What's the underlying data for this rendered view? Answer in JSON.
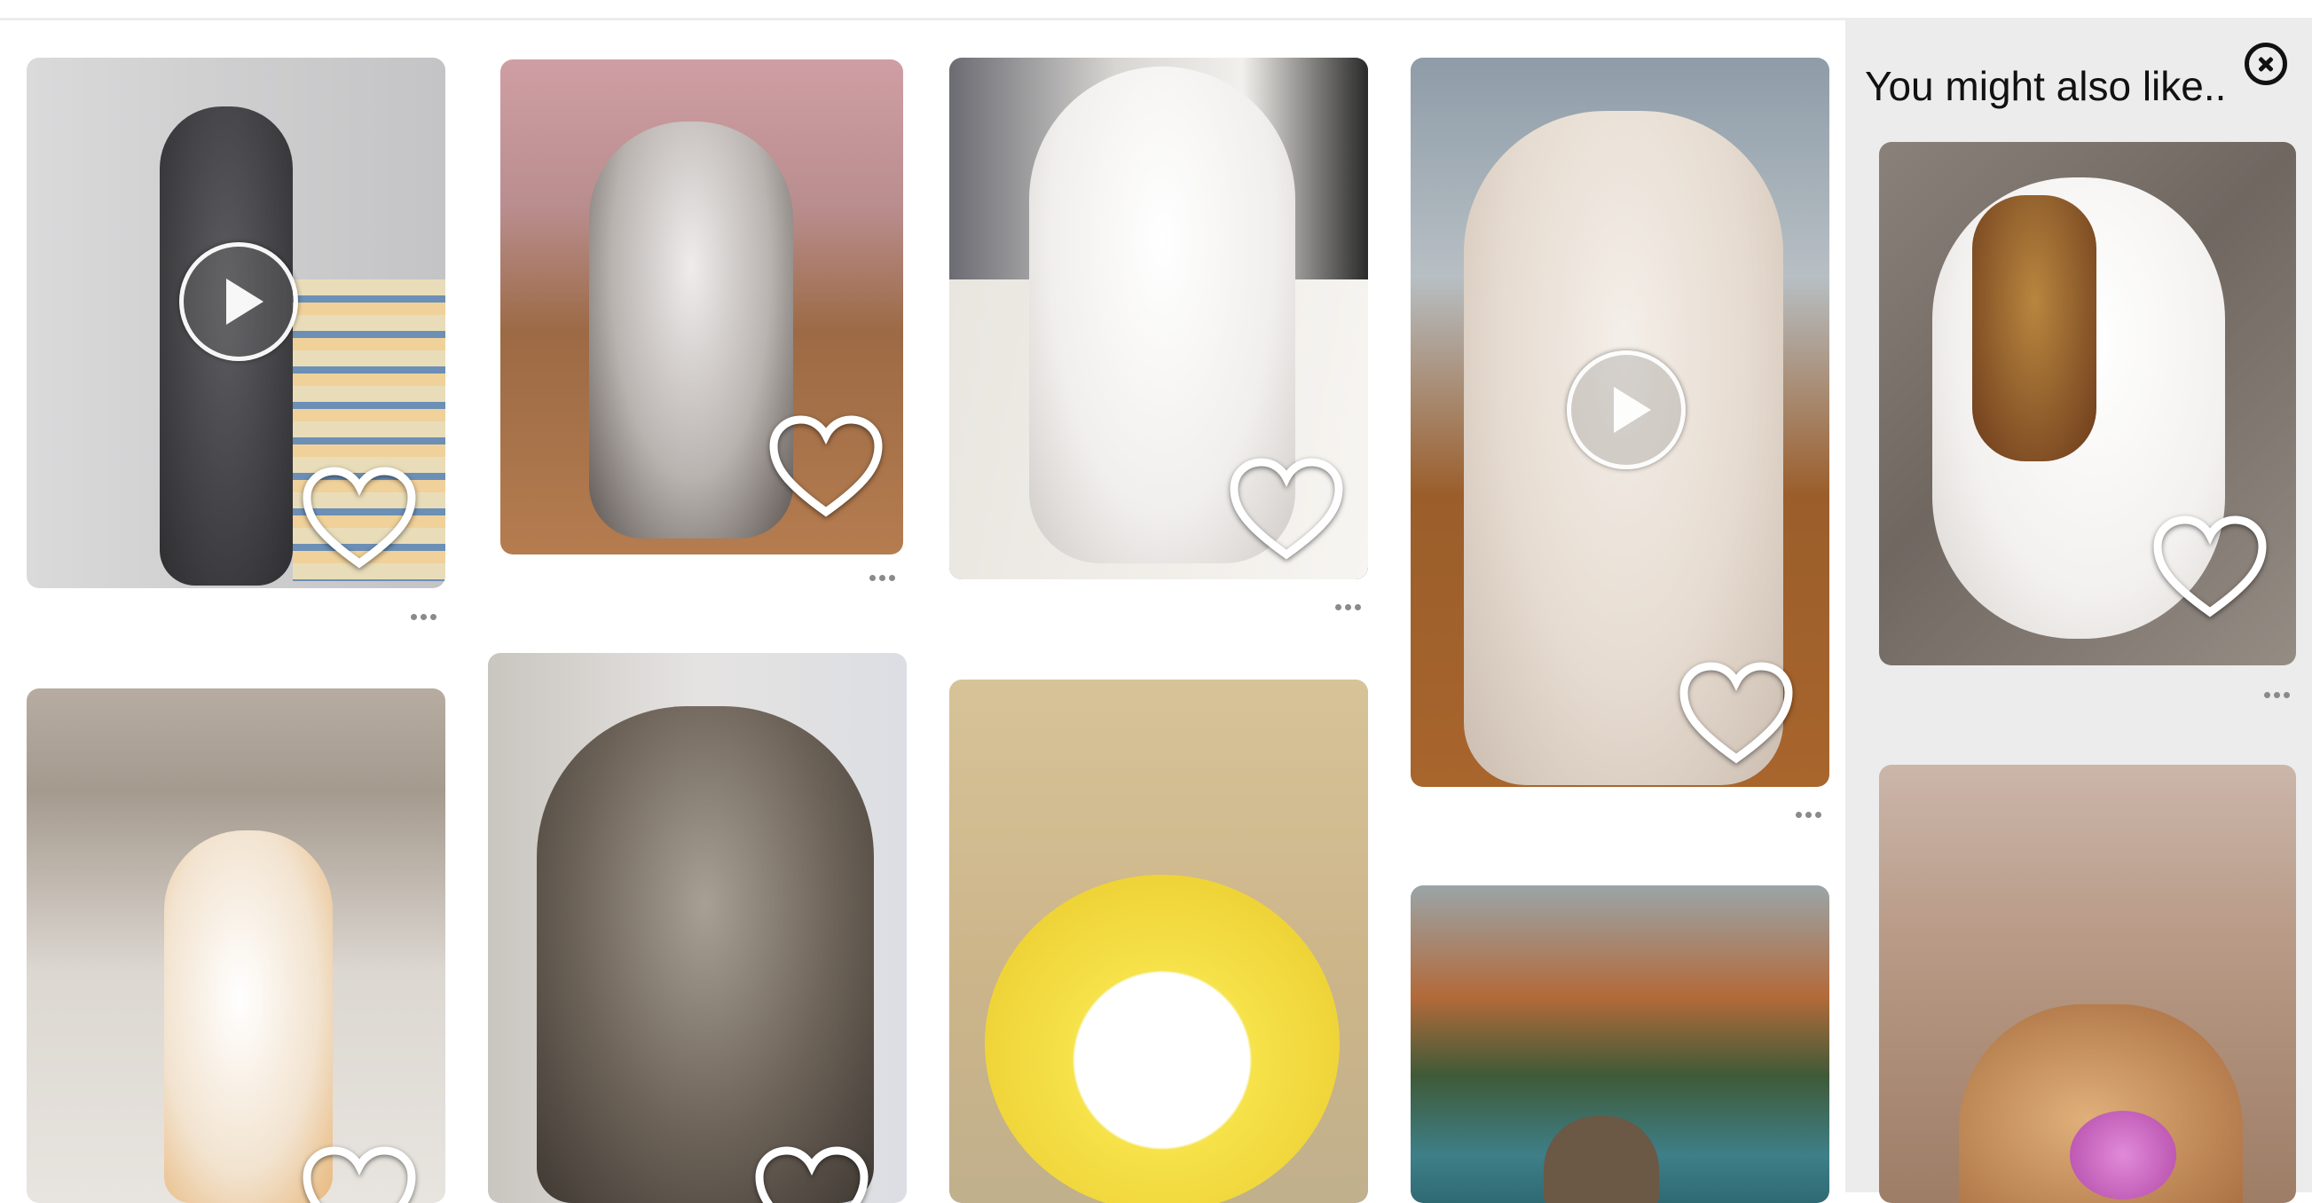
{
  "panel": {
    "title": "You might also like..",
    "close_icon": "close-circle-icon"
  },
  "icons": {
    "play": "play-icon",
    "heart": "heart-outline-icon",
    "more": "more-options-icon"
  },
  "colors": {
    "panel_bg": "#ececec",
    "page_bg": "#ffffff",
    "overlay_white": "#ffffff"
  }
}
